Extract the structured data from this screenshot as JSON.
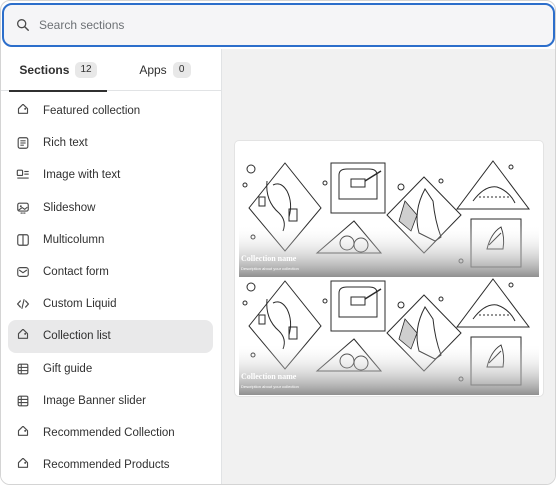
{
  "search": {
    "placeholder": "Search sections",
    "icon": "search-icon"
  },
  "tabs": [
    {
      "label": "Sections",
      "count": "12",
      "active": true
    },
    {
      "label": "Apps",
      "count": "0",
      "active": false
    }
  ],
  "sections": [
    {
      "label": "Featured collection",
      "icon": "tag-icon"
    },
    {
      "label": "Rich text",
      "icon": "text-block-icon"
    },
    {
      "label": "Image with text",
      "icon": "image-with-text-icon"
    },
    {
      "label": "Slideshow",
      "icon": "slideshow-icon"
    },
    {
      "label": "Multicolumn",
      "icon": "columns-icon"
    },
    {
      "label": "Contact form",
      "icon": "envelope-icon"
    },
    {
      "label": "Custom Liquid",
      "icon": "code-icon"
    },
    {
      "label": "Collection list",
      "icon": "tag-icon",
      "active": true
    },
    {
      "label": "Gift guide",
      "icon": "list-grid-icon"
    },
    {
      "label": "Image Banner slider",
      "icon": "list-grid-icon"
    },
    {
      "label": "Recommended Collection",
      "icon": "tag-icon"
    },
    {
      "label": "Recommended Products",
      "icon": "tag-icon"
    }
  ],
  "preview": {
    "cards": [
      {
        "title": "Collection name",
        "subtitle": "Description about your collection"
      },
      {
        "title": "Collection name",
        "subtitle": "Description about your collection"
      }
    ]
  },
  "colors": {
    "focus_ring": "#2c6ecb",
    "active_item_bg": "#e9e9ea",
    "panel_bg": "#f1f1f1"
  }
}
